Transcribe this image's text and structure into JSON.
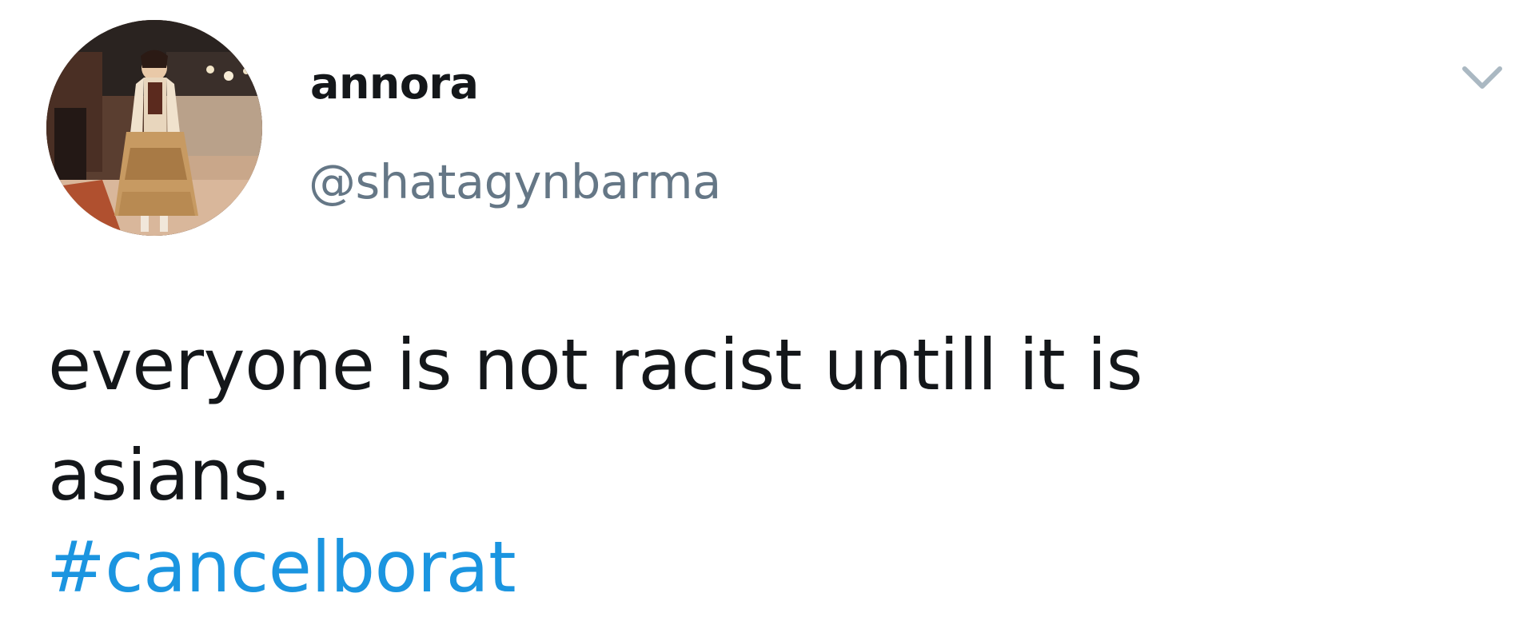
{
  "tweet": {
    "display_name": "annora",
    "handle": "@shatagynbarma",
    "text_line_1": "everyone is not racist untill it is",
    "text_line_2": "asians.",
    "hashtag": "#cancelborat"
  },
  "icons": {
    "menu": "chevron-down-icon",
    "avatar": "profile-photo"
  },
  "colors": {
    "text": "#14171a",
    "handle": "#657786",
    "link": "#1b95e0",
    "chevron": "#aab8c2",
    "background": "#ffffff"
  }
}
